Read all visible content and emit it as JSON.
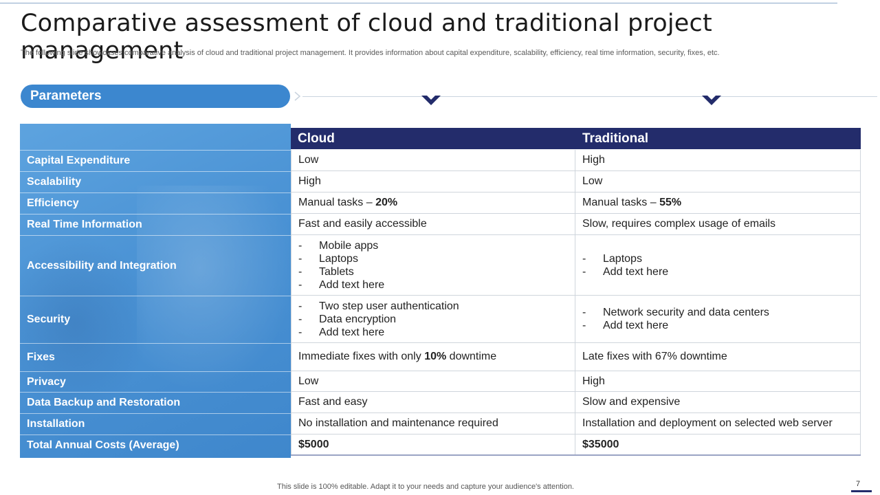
{
  "slide": {
    "title": "Comparative assessment of cloud and traditional project management",
    "subtitle": "The following slide showcases comparative analysis of cloud and traditional project management. It provides information about capital expenditure, scalability, efficiency, real time information, security, fixes, etc.",
    "parameters_label": "Parameters",
    "footer": "This slide is 100% editable. Adapt it to your needs and capture your audience's attention.",
    "page_number": "7"
  },
  "table": {
    "columns": [
      "Cloud",
      "Traditional"
    ],
    "rows": [
      {
        "param": "Capital Expenditure",
        "cloud": "Low",
        "traditional": "High"
      },
      {
        "param": "Scalability",
        "cloud": "High",
        "traditional": "Low"
      },
      {
        "param": "Efficiency",
        "cloud_prefix": "Manual tasks – ",
        "cloud_bold": "20%",
        "trad_prefix": "Manual tasks – ",
        "trad_bold": "55%"
      },
      {
        "param": "Real Time Information",
        "cloud": "Fast and easily accessible",
        "traditional": "Slow, requires complex usage of emails"
      },
      {
        "param": "Accessibility and Integration",
        "cloud_list": [
          "Mobile apps",
          "Laptops",
          "Tablets",
          "Add text here"
        ],
        "trad_list": [
          "Laptops",
          "Add text here"
        ]
      },
      {
        "param": "Security",
        "cloud_list": [
          "Two step user authentication",
          "Data encryption",
          "Add text here"
        ],
        "trad_list": [
          "Network security and data centers",
          "Add text here"
        ]
      },
      {
        "param": "Fixes",
        "cloud_prefix": "Immediate fixes with only ",
        "cloud_bold": "10%",
        "cloud_suffix": " downtime",
        "traditional": "Late fixes with 67% downtime"
      },
      {
        "param": "Privacy",
        "cloud": "Low",
        "traditional": "High"
      },
      {
        "param": "Data Backup and Restoration",
        "cloud": "Fast and easy",
        "traditional": "Slow and expensive"
      },
      {
        "param": "Installation",
        "cloud": "No installation and maintenance required",
        "traditional": "Installation  and deployment on selected web server"
      },
      {
        "param": "Total Annual Costs (Average)",
        "cloud_bold_only": "$5000",
        "trad_bold_only": "$35000"
      }
    ],
    "list_dash": "-"
  },
  "colors": {
    "accent_blue": "#3c87cf",
    "header_navy": "#232c6b"
  }
}
